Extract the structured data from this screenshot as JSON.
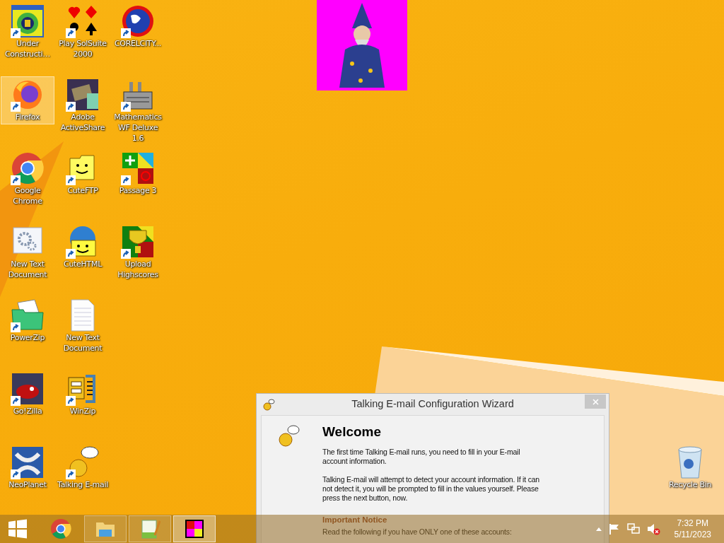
{
  "desktop": {
    "icon_columns": [
      [
        {
          "label": "Under Constructi…",
          "kind": "construction",
          "shortcut": true,
          "selected": false
        },
        {
          "label": "Firefox",
          "kind": "firefox",
          "shortcut": true,
          "selected": true
        },
        {
          "label": "Google Chrome",
          "kind": "chrome",
          "shortcut": true,
          "selected": false
        },
        {
          "label": "New Text Document",
          "kind": "gears",
          "shortcut": false,
          "selected": false
        },
        {
          "label": "PowerZip",
          "kind": "zipfolder",
          "shortcut": true,
          "selected": false
        },
        {
          "label": "Go!Zilla",
          "kind": "redphoto",
          "shortcut": true,
          "selected": false
        },
        {
          "label": "NeoPlanet",
          "kind": "neo",
          "shortcut": true,
          "selected": false
        }
      ],
      [
        {
          "label": "Play SolSuite 2000",
          "kind": "cards",
          "shortcut": true,
          "selected": false
        },
        {
          "label": "Adobe ActiveShare",
          "kind": "film",
          "shortcut": true,
          "selected": false
        },
        {
          "label": "CuteFTP",
          "kind": "smileyfolder",
          "shortcut": true,
          "selected": false
        },
        {
          "label": "CuteHTML",
          "kind": "smileyglobe",
          "shortcut": true,
          "selected": false
        },
        {
          "label": "New Text Document",
          "kind": "textdoc",
          "shortcut": false,
          "selected": false
        },
        {
          "label": "WinZip",
          "kind": "vise",
          "shortcut": true,
          "selected": false
        },
        {
          "label": "Talking E-mail",
          "kind": "talking",
          "shortcut": true,
          "selected": false
        }
      ],
      [
        {
          "label": "CORELCITY...",
          "kind": "globe",
          "shortcut": true,
          "selected": false
        },
        {
          "label": "Mathematics WF Deluxe 1.6",
          "kind": "factory",
          "shortcut": true,
          "selected": false
        },
        {
          "label": "Passage 3",
          "kind": "blocks",
          "shortcut": true,
          "selected": false
        },
        {
          "label": "Upload Highscores",
          "kind": "trophy",
          "shortcut": true,
          "selected": false
        }
      ]
    ],
    "recycle_bin": {
      "label": "Recycle Bin"
    }
  },
  "dialog": {
    "title": "Talking E-mail Configuration Wizard",
    "heading": "Welcome",
    "paragraphs": [
      "The first time Talking E-mail runs, you need to fill in your E-mail account information.",
      "Talking E-mail will attempt to detect your account information. If it can not detect it, you will be prompted to fill in the values yourself. Please press the next button, now."
    ],
    "notice_heading": "Important Notice",
    "notice_text": "Read the following if you have ONLY one of these accounts:"
  },
  "taskbar": {
    "apps": [
      {
        "kind": "chrome",
        "running": false,
        "selected": false
      },
      {
        "kind": "explorer",
        "running": true,
        "selected": false
      },
      {
        "kind": "notepad",
        "running": true,
        "selected": false
      },
      {
        "kind": "puzzle",
        "running": true,
        "selected": true
      }
    ],
    "clock": {
      "time": "7:32 PM",
      "date": "5/11/2023"
    }
  }
}
